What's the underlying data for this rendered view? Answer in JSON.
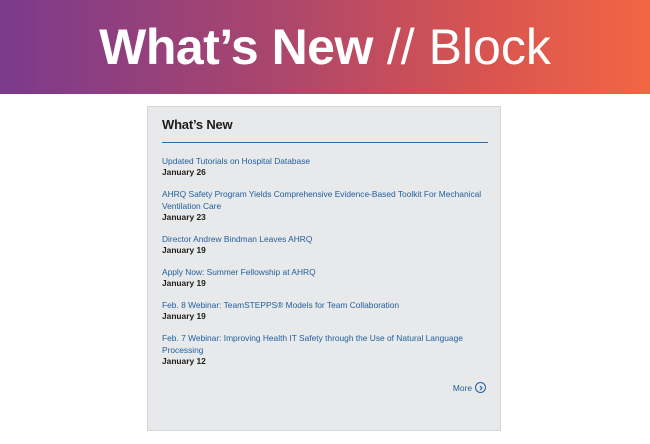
{
  "banner": {
    "title": "What’s New",
    "subtitle": "// Block"
  },
  "block": {
    "heading": "What’s New",
    "items": [
      {
        "title": "Updated Tutorials on Hospital Database",
        "date": "January 26"
      },
      {
        "title": "AHRQ Safety Program Yields Comprehensive Evidence-Based Toolkit For Mechanical Ventilation Care",
        "date": "January 23"
      },
      {
        "title": "Director Andrew Bindman Leaves AHRQ",
        "date": "January 19"
      },
      {
        "title": "Apply Now: Summer Fellowship at AHRQ",
        "date": "January 19"
      },
      {
        "title": "Feb. 8 Webinar: TeamSTEPPS® Models for Team Collaboration",
        "date": "January 19"
      },
      {
        "title": "Feb. 7 Webinar: Improving Health IT Safety through the Use of Natural Language Processing",
        "date": "January 12"
      }
    ],
    "more_label": "More",
    "more_icon": "chevron-right-circle-icon",
    "colors": {
      "link": "#1f5e9e",
      "rule": "#2e6da4",
      "background": "#e8e9ea",
      "banner_start": "#7b3a8c",
      "banner_end": "#f26644"
    }
  }
}
